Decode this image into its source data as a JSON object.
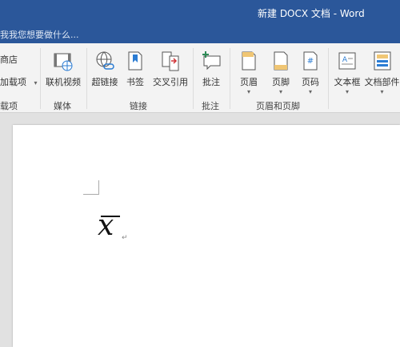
{
  "window": {
    "title": "新建 DOCX 文档 - Word"
  },
  "tell_me": "我我您想要做什么...",
  "ribbon": {
    "left_partial": {
      "item1": "商店",
      "item2": "加载项",
      "item2_arrow": "▾",
      "group": "载项"
    },
    "media": {
      "online_video": "联机视频",
      "group": "媒体"
    },
    "links": {
      "hyperlink": "超链接",
      "bookmark": "书签",
      "cross_reference": "交叉引用",
      "group": "链接"
    },
    "comments": {
      "comment": "批注",
      "group": "批注"
    },
    "header_footer": {
      "header": "页眉",
      "footer": "页脚",
      "page_number": "页码",
      "group": "页眉和页脚"
    },
    "text": {
      "text_box": "文本框",
      "quick_parts": "文档部件"
    },
    "dropdown_arrow": "▾"
  },
  "document": {
    "equation": "x",
    "paragraph_mark": "↵"
  }
}
